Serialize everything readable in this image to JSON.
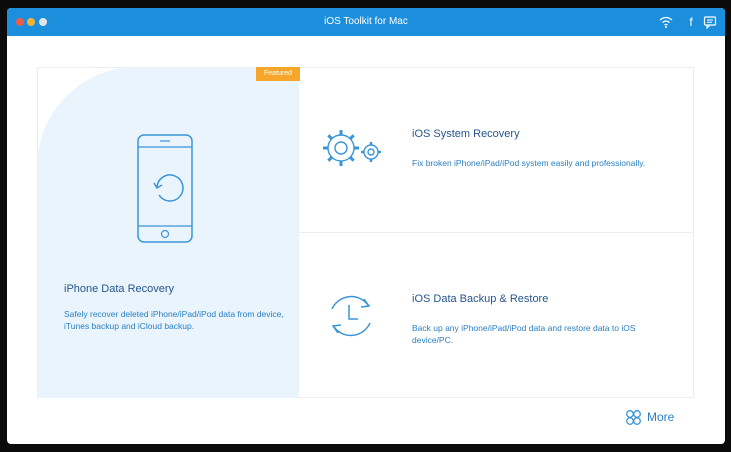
{
  "window": {
    "title": "iOS Toolkit for Mac",
    "toolbar_icons": [
      "wifi-icon",
      "facebook-icon",
      "message-icon"
    ],
    "facebook_glyph": "f"
  },
  "features": {
    "featured_badge": "Featured",
    "data_recovery": {
      "title": "iPhone Data Recovery",
      "description": "Safely recover deleted iPhone/iPad/iPod data from device, iTunes backup and iCloud backup.",
      "icon": "phone-recovery-icon"
    },
    "system_recovery": {
      "title": "iOS System Recovery",
      "description": "Fix broken iPhone/iPad/iPod system easily and professionally.",
      "icon": "gears-icon"
    },
    "backup_restore": {
      "title": "iOS Data Backup & Restore",
      "description": "Back up any iPhone/iPad/iPod data and restore data to iOS device/PC.",
      "icon": "clock-sync-icon"
    }
  },
  "footer": {
    "more_label": "More",
    "more_icon": "clover-icon"
  },
  "colors": {
    "titlebar": "#1b8fdc",
    "featured_panel": "#e9f4fd",
    "badge": "#f5a62b",
    "heading_text": "#27568c",
    "body_text": "#2a7fc2"
  }
}
